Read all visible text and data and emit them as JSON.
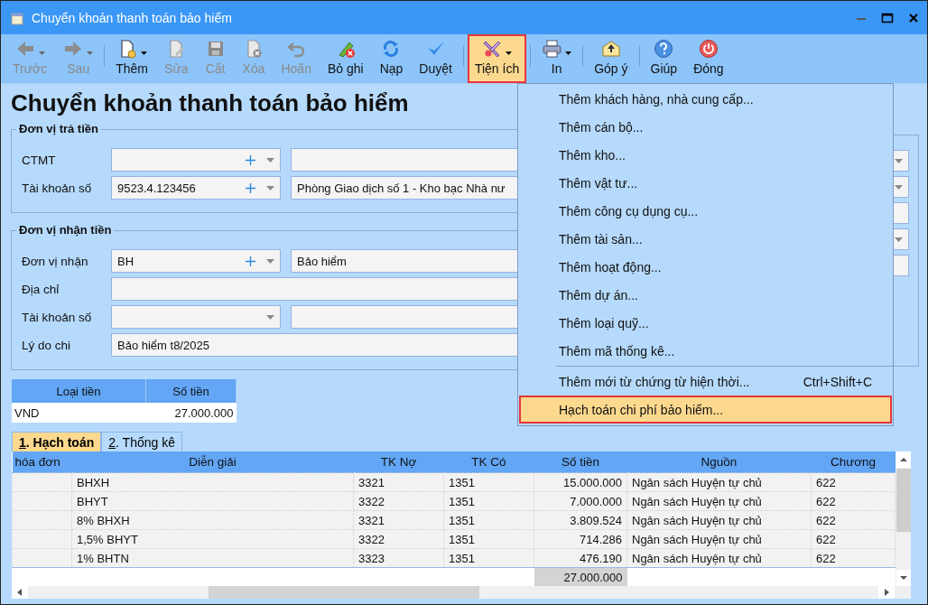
{
  "window": {
    "title": "Chuyển khoản thanh toán bảo hiểm"
  },
  "toolbar": [
    [
      {
        "kind": "back",
        "label": "Trước",
        "disabled": true,
        "dropdown": true,
        "selected": false
      },
      {
        "kind": "forward",
        "label": "Sau",
        "disabled": true,
        "dropdown": true,
        "selected": false
      }
    ],
    [
      {
        "kind": "new",
        "label": "Thêm",
        "disabled": false,
        "dropdown": true,
        "selected": false
      },
      {
        "kind": "edit",
        "label": "Sửa",
        "disabled": true,
        "dropdown": false,
        "selected": false
      },
      {
        "kind": "save",
        "label": "Cất",
        "disabled": true,
        "dropdown": false,
        "selected": false
      },
      {
        "kind": "delete",
        "label": "Xóa",
        "disabled": true,
        "dropdown": false,
        "selected": false
      },
      {
        "kind": "undo",
        "label": "Hoãn",
        "disabled": true,
        "dropdown": false,
        "selected": false
      },
      {
        "kind": "unpost",
        "label": "Bỏ ghi",
        "disabled": false,
        "dropdown": false,
        "selected": false
      },
      {
        "kind": "reload",
        "label": "Nạp",
        "disabled": false,
        "dropdown": false,
        "selected": false
      },
      {
        "kind": "approve",
        "label": "Duyệt",
        "disabled": false,
        "dropdown": false,
        "selected": false
      }
    ],
    [
      {
        "kind": "tools",
        "label": "Tiện ích",
        "disabled": false,
        "dropdown": true,
        "selected": true
      }
    ],
    [
      {
        "kind": "print",
        "label": "In",
        "disabled": false,
        "dropdown": true,
        "selected": false
      }
    ],
    [
      {
        "kind": "feedback",
        "label": "Góp ý",
        "disabled": false,
        "dropdown": false,
        "selected": false
      }
    ],
    [
      {
        "kind": "help",
        "label": "Giúp",
        "disabled": false,
        "dropdown": false,
        "selected": false
      },
      {
        "kind": "close",
        "label": "Đóng",
        "disabled": false,
        "dropdown": false,
        "selected": false
      }
    ]
  ],
  "heading": "Chuyển khoản thanh toán bảo hiểm",
  "groups": [
    {
      "title": "Đơn vị trả tiền",
      "rows": [
        {
          "label": "CTMT",
          "fields": [
            {
              "kind": "combo_add"
            },
            {
              "kind": "text"
            }
          ]
        },
        {
          "label": "Tài khoản số",
          "fields": [
            {
              "kind": "combo_add",
              "value": "9523.4.123456"
            },
            {
              "kind": "text",
              "value": "Phòng Giao dịch số 1 - Kho bạc Nhà nư"
            }
          ]
        }
      ]
    },
    {
      "title": "Đơn vị nhận tiền",
      "rows": [
        {
          "label": "Đơn vị nhận",
          "fields": [
            {
              "kind": "combo_add",
              "value": "BH"
            },
            {
              "kind": "text",
              "value": "Bảo hiểm"
            }
          ]
        },
        {
          "label": "Địa chỉ",
          "fields": [
            {
              "kind": "wide"
            }
          ]
        },
        {
          "label": "Tài khoản số",
          "fields": [
            {
              "kind": "combo"
            },
            {
              "kind": "text"
            }
          ]
        },
        {
          "label": "Lý do chi",
          "fields": [
            {
              "kind": "wide",
              "value": "Bảo hiểm t8/2025"
            }
          ]
        }
      ]
    }
  ],
  "side_panel": {
    "fields": [
      {
        "kind": "combo"
      },
      {
        "kind": "combo"
      },
      {
        "kind": "text"
      },
      {
        "kind": "combo"
      },
      {
        "kind": "text"
      }
    ]
  },
  "currency_table": {
    "columns": [
      "Loại tiền",
      "Số tiền"
    ],
    "rows": [
      [
        "VND",
        "27.000.000"
      ]
    ]
  },
  "tabs": [
    {
      "label": "1. Hạch toán",
      "selected": true
    },
    {
      "label": "2. Thống kê",
      "selected": false
    }
  ],
  "grid": {
    "columns": [
      {
        "label": "hóa đơn",
        "kind": "text"
      },
      {
        "label": "Diễn giải",
        "kind": "text"
      },
      {
        "label": "TK Nợ",
        "kind": "text"
      },
      {
        "label": "TK Có",
        "kind": "text"
      },
      {
        "label": "Số tiền",
        "kind": "amount"
      },
      {
        "label": "Nguồn",
        "kind": "text"
      },
      {
        "label": "Chương",
        "kind": "text"
      }
    ],
    "rows": [
      [
        null,
        "BHXH",
        "3321",
        "1351",
        "15.000.000",
        "Ngân sách Huyện tự chủ",
        "622"
      ],
      [
        null,
        "BHYT",
        "3322",
        "1351",
        "7.000.000",
        "Ngân sách Huyện tự chủ",
        "622"
      ],
      [
        null,
        "8% BHXH",
        "3321",
        "1351",
        "3.809.524",
        "Ngân sách Huyện tự chủ",
        "622"
      ],
      [
        null,
        "1,5% BHYT",
        "3322",
        "1351",
        "714.286",
        "Ngân sách Huyện tự chủ",
        "622"
      ],
      [
        null,
        "1% BHTN",
        "3323",
        "1351",
        "476.190",
        "Ngân sách Huyện tự chủ",
        "622"
      ]
    ],
    "total": "27.000.000"
  },
  "menu": {
    "groups": [
      [
        {
          "label": "Thêm khách hàng, nhà cung cấp...",
          "selected": false
        },
        {
          "label": "Thêm cán bộ...",
          "selected": false
        },
        {
          "label": "Thêm kho...",
          "selected": false
        },
        {
          "label": "Thêm vật tư...",
          "selected": false
        },
        {
          "label": "Thêm công cụ dụng cụ...",
          "selected": false
        },
        {
          "label": "Thêm tài sản...",
          "selected": false
        },
        {
          "label": "Thêm hoạt động...",
          "selected": false
        },
        {
          "label": "Thêm dự án...",
          "selected": false
        },
        {
          "label": "Thêm loại quỹ...",
          "selected": false
        },
        {
          "label": "Thêm mã thống kê...",
          "selected": false
        }
      ],
      [
        {
          "label": "Thêm mới từ chứng từ hiện thời...",
          "shortcut": "Ctrl+Shift+C",
          "selected": false
        },
        {
          "label": "Hạch toán chi phí bảo hiểm...",
          "selected": true
        }
      ]
    ]
  }
}
